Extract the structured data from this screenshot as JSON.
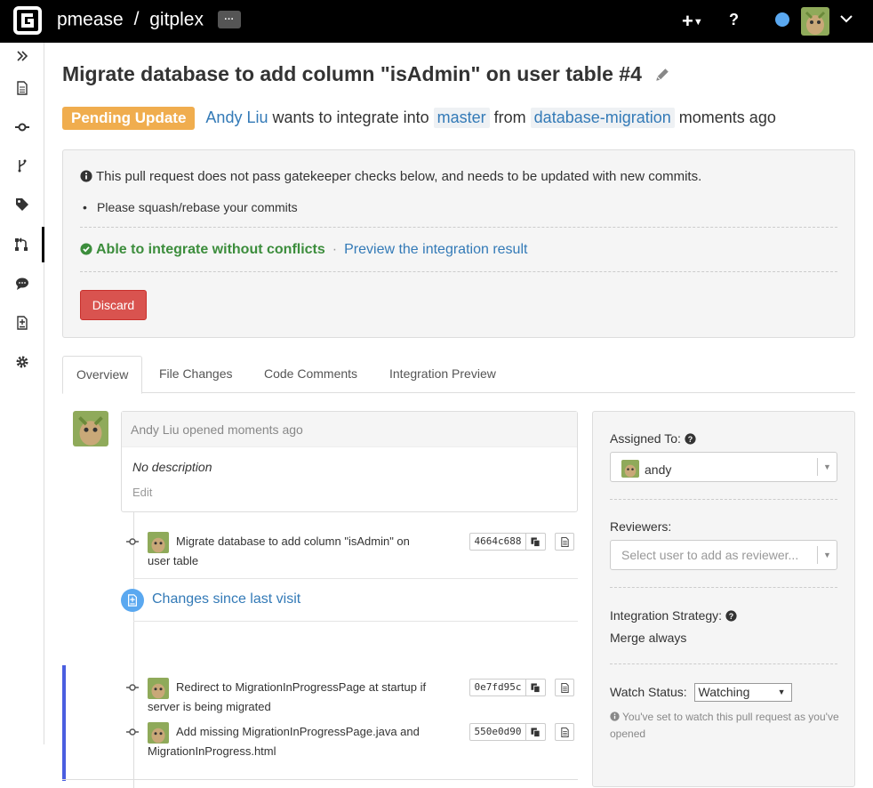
{
  "header": {
    "owner": "pmease",
    "separator": "/",
    "repo": "gitplex",
    "more_label": "···",
    "plus_label": "+",
    "help_label": "?"
  },
  "sidebar": {
    "items": [
      "files-icon",
      "commits-icon",
      "branches-icon",
      "tags-icon",
      "pull-requests-icon",
      "comments-icon",
      "compare-icon",
      "settings-icon"
    ],
    "active_index": 4
  },
  "pull_request": {
    "title": "Migrate database to add column \"isAdmin\" on user table #4",
    "status": "Pending Update",
    "author": "Andy Liu",
    "action_text": "wants to integrate into",
    "target_branch": "master",
    "from_text": "from",
    "source_branch": "database-migration",
    "time_text": "moments ago"
  },
  "checks": {
    "message": "This pull request does not pass gatekeeper checks below, and needs to be updated with new commits.",
    "bullet": "Please squash/rebase your commits",
    "conflict_status": "Able to integrate without conflicts",
    "separator": "·",
    "preview_link": "Preview the integration result",
    "discard_label": "Discard"
  },
  "tabs": [
    {
      "label": "Overview",
      "active": true
    },
    {
      "label": "File Changes",
      "active": false
    },
    {
      "label": "Code Comments",
      "active": false
    },
    {
      "label": "Integration Preview",
      "active": false
    }
  ],
  "timeline": {
    "opened_text": "Andy Liu opened moments ago",
    "description": "No description",
    "edit_label": "Edit",
    "since_visit_label": "Changes since last visit",
    "commits": [
      {
        "message": "Migrate database to add column \"isAdmin\" on user table",
        "hash": "4664c688"
      },
      {
        "message": "Redirect to MigrationInProgressPage at startup if server is being migrated",
        "hash": "0e7fd95c"
      },
      {
        "message": "Add missing MigrationInProgressPage.java and MigrationInProgress.html",
        "hash": "550e0d90"
      }
    ]
  },
  "side_panel": {
    "assigned_label": "Assigned To:",
    "assigned_value": "andy",
    "reviewers_label": "Reviewers:",
    "reviewers_placeholder": "Select user to add as reviewer...",
    "strategy_label": "Integration Strategy:",
    "strategy_value": "Merge always",
    "watch_label": "Watch Status:",
    "watch_value": "Watching",
    "watch_note": "You've set to watch this pull request as you've opened"
  },
  "colors": {
    "pending": "#f0ad4e",
    "success": "#3c8d3c",
    "link": "#337ab7",
    "danger": "#d9534f",
    "new_marker": "#4a5ee0"
  }
}
